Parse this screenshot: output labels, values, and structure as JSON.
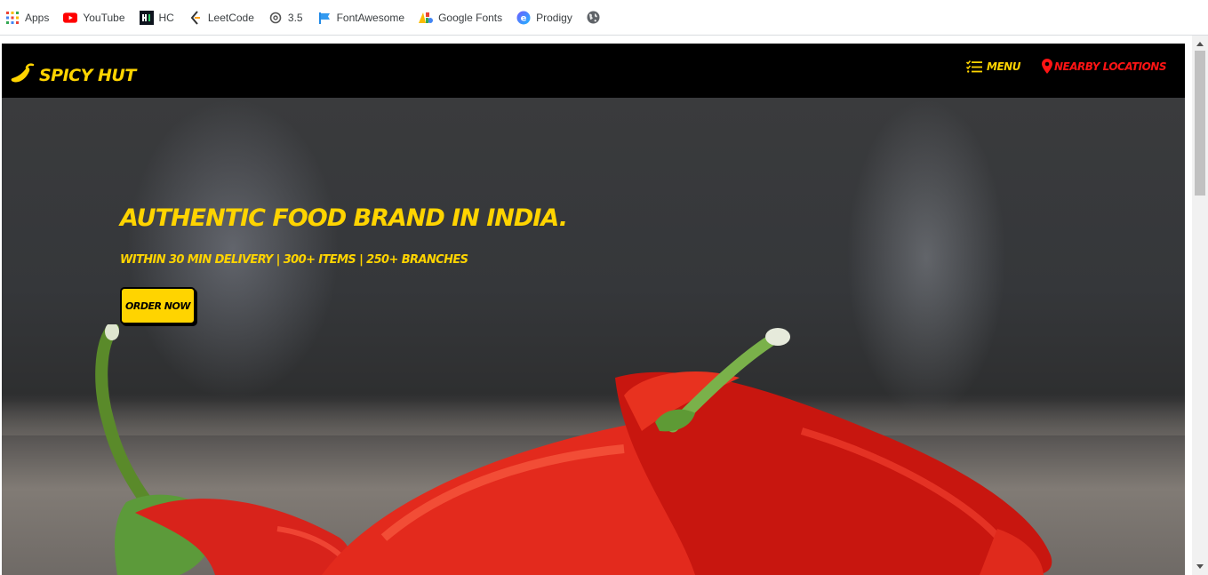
{
  "bookmarks": [
    {
      "label": "Apps",
      "icon": "apps-grid-icon"
    },
    {
      "label": "YouTube",
      "icon": "youtube-icon"
    },
    {
      "label": "HC",
      "icon": "hc-icon"
    },
    {
      "label": "LeetCode",
      "icon": "leetcode-icon"
    },
    {
      "label": "3.5",
      "icon": "openai-icon"
    },
    {
      "label": "FontAwesome",
      "icon": "flag-icon"
    },
    {
      "label": "Google Fonts",
      "icon": "google-fonts-icon"
    },
    {
      "label": "Prodigy",
      "icon": "prodigy-icon"
    },
    {
      "label": "",
      "icon": "globe-icon"
    }
  ],
  "navbar": {
    "brand": "Spicy Hut",
    "menu_label": "Menu",
    "locations_label": "Nearby Locations"
  },
  "hero": {
    "title": "Authentic food brand in India.",
    "subtitle": "Within 30 min delivery | 300+ items | 250+ branches",
    "cta": "Order Now"
  },
  "colors": {
    "accent_yellow": "#ffd400",
    "accent_red": "#ff1414",
    "navbar_bg": "#000000"
  }
}
